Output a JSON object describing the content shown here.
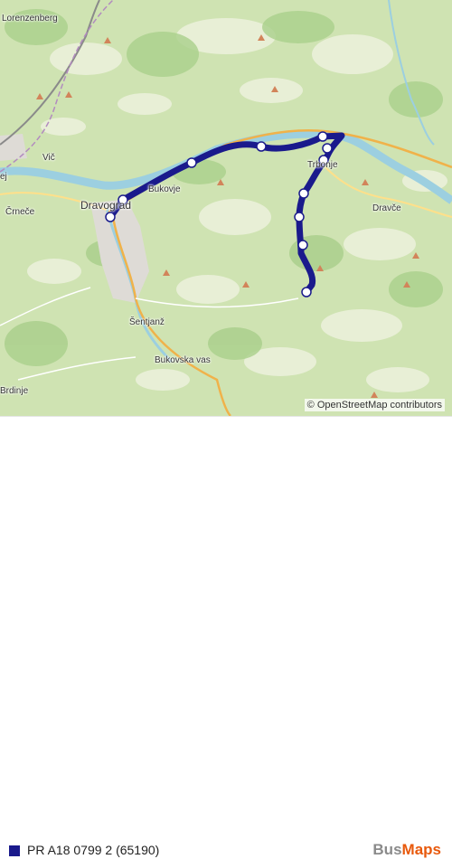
{
  "map": {
    "places": [
      {
        "id": "lorenzenberg",
        "label": "Lorenzenberg"
      },
      {
        "id": "vic",
        "label": "Vič"
      },
      {
        "id": "ej",
        "label": "ej"
      },
      {
        "id": "crnece",
        "label": "Črneče"
      },
      {
        "id": "dravograd",
        "label": "Dravograd"
      },
      {
        "id": "bukovje",
        "label": "Bukovje"
      },
      {
        "id": "trbonje",
        "label": "Trbonje"
      },
      {
        "id": "dravce",
        "label": "Dravče"
      },
      {
        "id": "sentjanz",
        "label": "Šentjanž"
      },
      {
        "id": "bukovska-vas",
        "label": "Bukovska vas"
      },
      {
        "id": "brdinje",
        "label": "Brdinje"
      }
    ],
    "attribution": "© OpenStreetMap contributors",
    "route_color": "#1a1a8c",
    "river_color": "#9ccfe0",
    "stop_count": 10
  },
  "legend": {
    "route_label": "PR A18 0799 2 (65190)",
    "swatch_color": "#1a1a8c"
  },
  "brand": {
    "part1": "Bus",
    "part2": "Maps"
  }
}
